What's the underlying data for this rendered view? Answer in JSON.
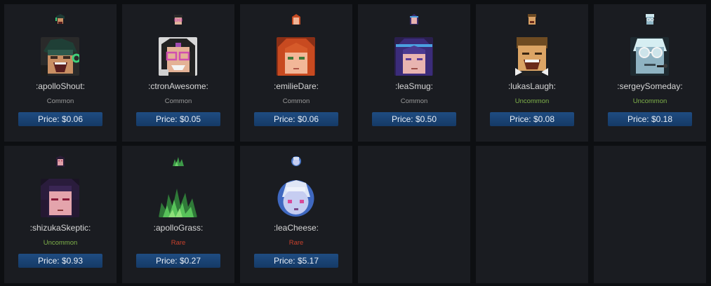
{
  "emotes": [
    {
      "name": ":apolloShout:",
      "rarity": "Common",
      "price": "Price: $0.06"
    },
    {
      "name": ":ctronAwesome:",
      "rarity": "Common",
      "price": "Price: $0.05"
    },
    {
      "name": ":emilieDare:",
      "rarity": "Common",
      "price": "Price: $0.06"
    },
    {
      "name": ":leaSmug:",
      "rarity": "Common",
      "price": "Price: $0.50"
    },
    {
      "name": ":lukasLaugh:",
      "rarity": "Uncommon",
      "price": "Price: $0.08"
    },
    {
      "name": ":sergeySomeday:",
      "rarity": "Uncommon",
      "price": "Price: $0.18"
    },
    {
      "name": ":shizukaSkeptic:",
      "rarity": "Uncommon",
      "price": "Price: $0.93"
    },
    {
      "name": ":apolloGrass:",
      "rarity": "Rare",
      "price": "Price: $0.27"
    },
    {
      "name": ":leaCheese:",
      "rarity": "Rare",
      "price": "Price: $5.17"
    }
  ],
  "colors": {
    "common": "#9a9a9a",
    "uncommon": "#7fb24a",
    "rare": "#c8412c",
    "button": "#1a4373"
  }
}
